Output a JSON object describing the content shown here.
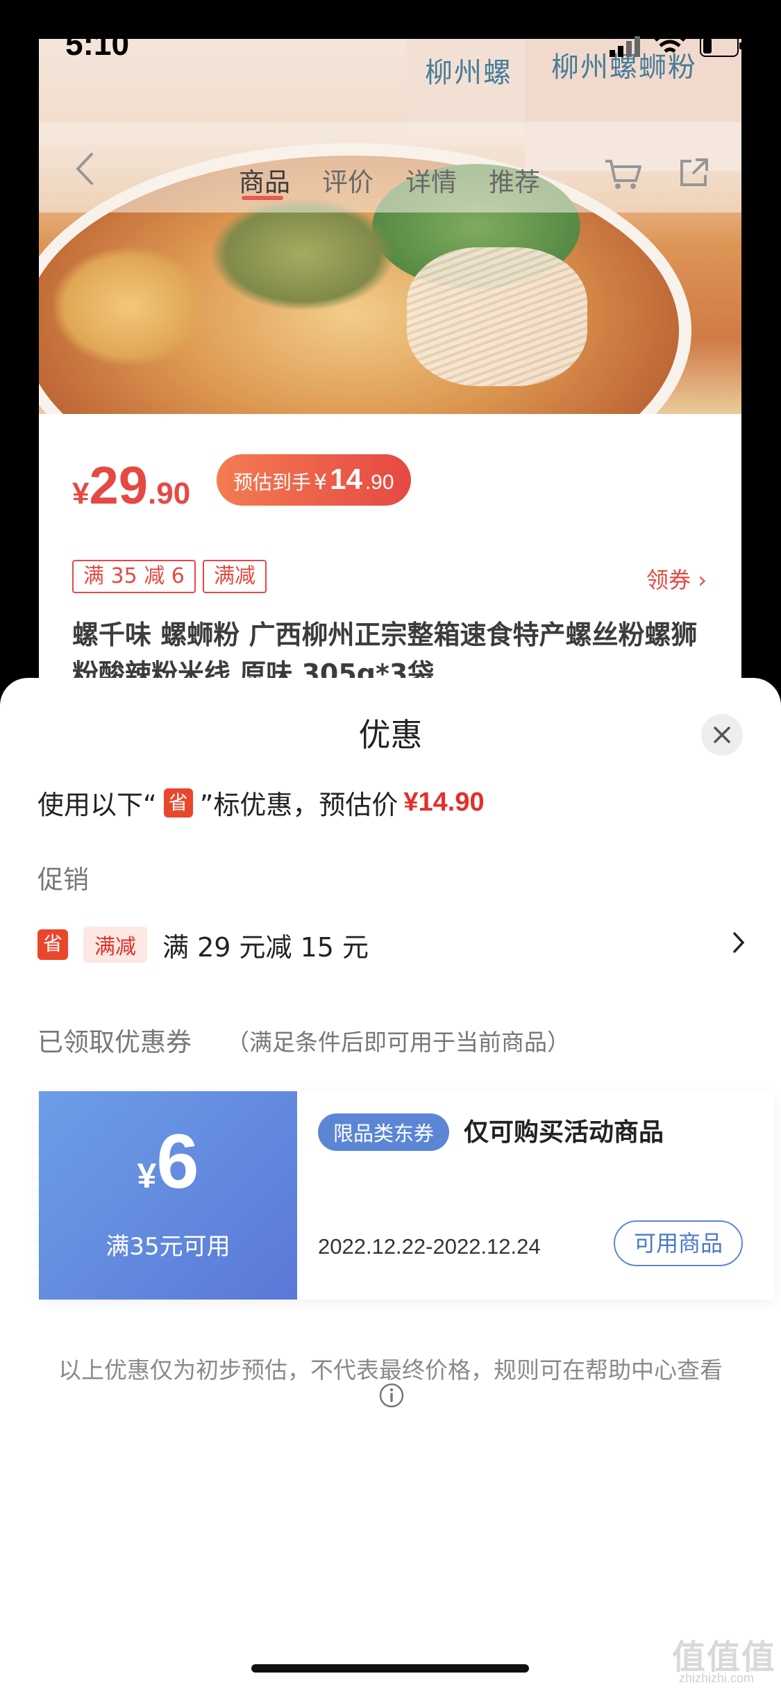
{
  "status_bar": {
    "time": "5:10"
  },
  "product_nav": {
    "tabs": [
      "商品",
      "评价",
      "详情",
      "推荐"
    ],
    "active_tab": 0
  },
  "hero": {
    "pack_text_1": "柳州螺",
    "pack_text_2": "柳州螺蛳粉"
  },
  "price": {
    "yen": "¥",
    "integer": "29",
    "decimal": ".90"
  },
  "estimate_pill": {
    "label": "预估到手",
    "yen": "¥",
    "integer": "14",
    "decimal": ".90"
  },
  "promo_tags": [
    "满 35 减 6",
    "满减"
  ],
  "coupon_link": "领券 ›",
  "product_title": "螺千味 螺蛳粉 广西柳州正宗整箱速食特产螺丝粉螺狮粉酸辣粉米线 原味 305g*3袋",
  "sheet": {
    "title": "优惠",
    "summary_before": "使用以下“",
    "sheng_badge": "省",
    "summary_after": "”标优惠，预估价",
    "estimated_price": "¥14.90",
    "promotion_section": "促销",
    "promotion": {
      "badge": "省",
      "tag": "满减",
      "text": "满 29 元减 15 元"
    },
    "coupons_section": "已领取优惠券",
    "coupons_note": "（满足条件后即可用于当前商品）",
    "coupon": {
      "yen": "¥",
      "amount": "6",
      "condition": "满35元可用",
      "tag": "限品类东券",
      "title": "仅可购买活动商品",
      "date_range": "2022.12.22-2022.12.24",
      "button": "可用商品"
    },
    "disclaimer": "以上优惠仅为初步预估，不代表最终价格，规则可在帮助中心查看"
  },
  "watermark": {
    "main": "值值值",
    "sub": "zhizhizhi.com"
  },
  "colors": {
    "accent_red": "#e2302a",
    "coupon_blue": "#5a78d8"
  }
}
